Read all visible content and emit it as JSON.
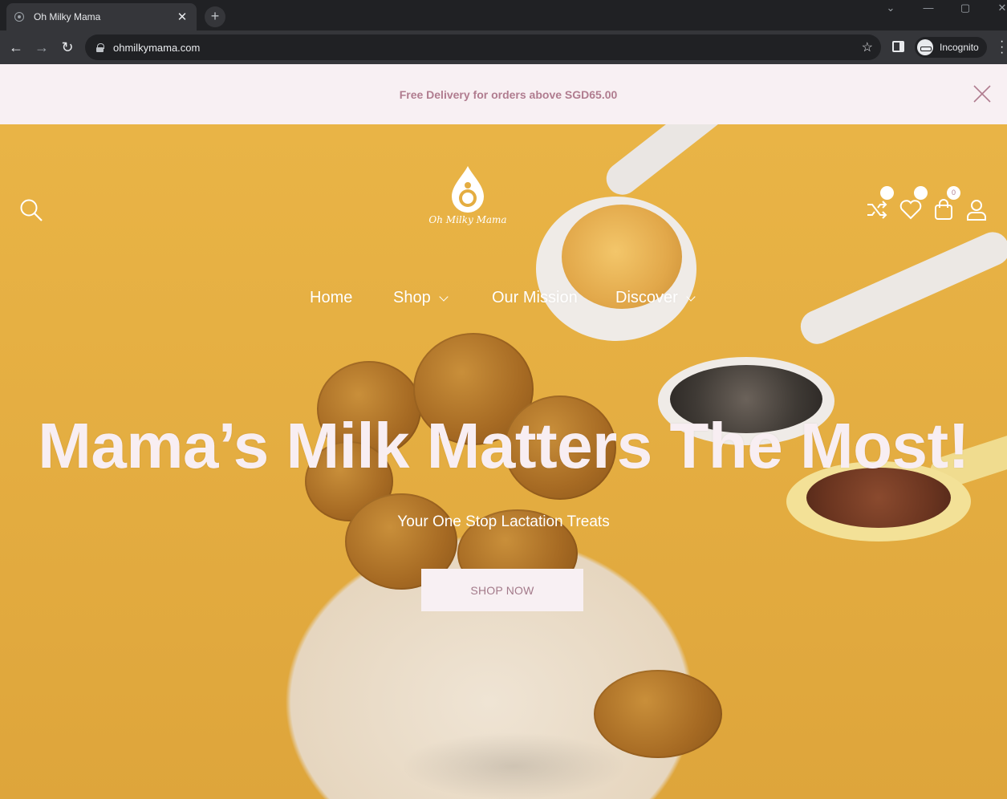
{
  "browser": {
    "tab_title": "Oh Milky Mama",
    "tab_close": "✕",
    "new_tab": "+",
    "url": "ohmilkymama.com",
    "profile_label": "Incognito"
  },
  "announcement": {
    "text": "Free Delivery for orders above SGD65.00"
  },
  "header": {
    "logo_text": "Oh Milky Mama",
    "cart_count": "0"
  },
  "nav": {
    "items": [
      {
        "label": "Home"
      },
      {
        "label": "Shop"
      },
      {
        "label": "Our Mission"
      },
      {
        "label": "Discover"
      }
    ]
  },
  "hero": {
    "headline": "Mama’s Milk Matters The Most!",
    "subheadline": "Your One Stop Lactation Treats",
    "cta_label": "SHOP NOW"
  },
  "colors": {
    "accent": "#b07c8f",
    "announcement_bg": "#f8f0f3",
    "hero_bg": "#e4ad41"
  }
}
